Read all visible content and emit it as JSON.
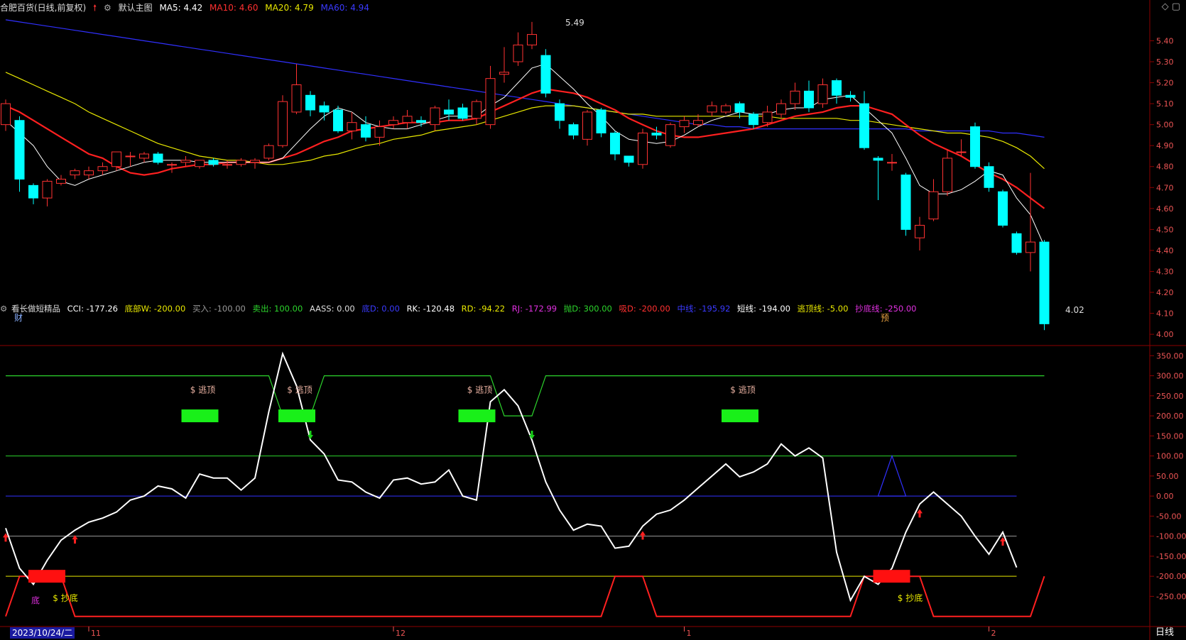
{
  "header": {
    "stock": "合肥百货(日线,前复权)",
    "main_chart": "默认主图",
    "ma5_label": "MA5: 4.42",
    "ma10_label": "MA10: 4.60",
    "ma20_label": "MA20: 4.79",
    "ma60_label": "MA60: 4.94"
  },
  "sub_header": {
    "indicator": "看长做短精品",
    "cci": "CCI: -177.26",
    "dibuw": "底部W: -200.00",
    "mairu": "买入: -100.00",
    "maichu": "卖出: 100.00",
    "aass": "AASS: 0.00",
    "di": "底D: 0.00",
    "rk": "RK: -120.48",
    "rd": "RD: -94.22",
    "rj": "RJ: -172.99",
    "paod": "抛D: 300.00",
    "xid": "吸D: -200.00",
    "zhongxian": "中线: -195.92",
    "duanxian": "短线: -194.00",
    "taodingxian": "逃顶线: -5.00",
    "chaodixian": "抄底线: -250.00"
  },
  "colors": {
    "up": "#ff3232",
    "down": "#00ffff",
    "ma5": "#ffffff",
    "ma10": "#ff2020",
    "ma20": "#e8e800",
    "ma60": "#3030ff",
    "grid": "#8b0000",
    "text": "#ddd"
  },
  "labels": {
    "high_marker": "5.49",
    "low_marker": "4.02",
    "cai": "财",
    "yu": "预",
    "escape": "$ 逃顶",
    "bottom": "$ 抄底",
    "di": "底",
    "date_box": "2023/10/24/二",
    "scope": "日线",
    "corner": "◇ ▢"
  },
  "chart_data": [
    {
      "type": "candlestick",
      "title": "合肥百货(日线,前复权)",
      "ylim": [
        3.97,
        5.52
      ],
      "yticks": [
        4.0,
        4.1,
        4.2,
        4.3,
        4.4,
        4.5,
        4.6,
        4.7,
        4.8,
        4.9,
        5.0,
        5.1,
        5.2,
        5.3,
        5.4
      ],
      "candles": [
        [
          5.0,
          5.1,
          5.12,
          4.97
        ],
        [
          5.02,
          4.74,
          5.04,
          4.68
        ],
        [
          4.71,
          4.65,
          4.72,
          4.62
        ],
        [
          4.65,
          4.73,
          4.74,
          4.61
        ],
        [
          4.72,
          4.74,
          4.76,
          4.71
        ],
        [
          4.76,
          4.78,
          4.79,
          4.74
        ],
        [
          4.76,
          4.78,
          4.8,
          4.74
        ],
        [
          4.78,
          4.8,
          4.82,
          4.76
        ],
        [
          4.8,
          4.87,
          4.87,
          4.78
        ],
        [
          4.85,
          4.85,
          4.87,
          4.8
        ],
        [
          4.84,
          4.86,
          4.87,
          4.82
        ],
        [
          4.86,
          4.82,
          4.87,
          4.81
        ],
        [
          4.81,
          4.81,
          4.82,
          4.77
        ],
        [
          4.82,
          4.83,
          4.85,
          4.8
        ],
        [
          4.8,
          4.83,
          4.83,
          4.79
        ],
        [
          4.83,
          4.81,
          4.84,
          4.8
        ],
        [
          4.81,
          4.81,
          4.83,
          4.79
        ],
        [
          4.81,
          4.83,
          4.84,
          4.8
        ],
        [
          4.82,
          4.83,
          4.84,
          4.79
        ],
        [
          4.84,
          4.9,
          4.91,
          4.83
        ],
        [
          4.9,
          5.11,
          5.14,
          4.89
        ],
        [
          5.06,
          5.19,
          5.29,
          5.05
        ],
        [
          5.14,
          5.07,
          5.16,
          5.04
        ],
        [
          5.09,
          5.06,
          5.11,
          5.02
        ],
        [
          5.07,
          4.97,
          5.09,
          4.96
        ],
        [
          4.97,
          5.01,
          5.06,
          4.93
        ],
        [
          5.0,
          4.94,
          5.04,
          4.92
        ],
        [
          4.94,
          4.99,
          5.02,
          4.9
        ],
        [
          5.0,
          5.02,
          5.04,
          4.98
        ],
        [
          5.01,
          5.04,
          5.07,
          4.98
        ],
        [
          5.02,
          5.01,
          5.04,
          4.99
        ],
        [
          5.0,
          5.08,
          5.09,
          4.97
        ],
        [
          5.07,
          5.05,
          5.12,
          5.02
        ],
        [
          5.08,
          5.03,
          5.1,
          5.02
        ],
        [
          5.03,
          5.11,
          5.12,
          5.0
        ],
        [
          5.0,
          5.22,
          5.28,
          4.98
        ],
        [
          5.24,
          5.25,
          5.37,
          5.2
        ],
        [
          5.3,
          5.38,
          5.44,
          5.28
        ],
        [
          5.38,
          5.43,
          5.49,
          5.36
        ],
        [
          5.33,
          5.15,
          5.36,
          5.13
        ],
        [
          5.1,
          5.02,
          5.12,
          4.98
        ],
        [
          5.0,
          4.95,
          5.01,
          4.93
        ],
        [
          4.93,
          5.06,
          5.07,
          4.9
        ],
        [
          5.07,
          4.96,
          5.08,
          4.94
        ],
        [
          4.96,
          4.86,
          4.97,
          4.83
        ],
        [
          4.85,
          4.82,
          4.85,
          4.8
        ],
        [
          4.81,
          4.96,
          4.98,
          4.79
        ],
        [
          4.96,
          4.95,
          4.99,
          4.93
        ],
        [
          4.9,
          5.0,
          5.01,
          4.89
        ],
        [
          4.99,
          5.02,
          5.04,
          4.96
        ],
        [
          5.0,
          5.02,
          5.05,
          4.99
        ],
        [
          5.06,
          5.09,
          5.11,
          5.04
        ],
        [
          5.06,
          5.09,
          5.1,
          5.05
        ],
        [
          5.1,
          5.06,
          5.11,
          5.03
        ],
        [
          5.05,
          5.0,
          5.06,
          4.98
        ],
        [
          5.01,
          5.06,
          5.09,
          4.99
        ],
        [
          5.05,
          5.1,
          5.12,
          5.03
        ],
        [
          5.1,
          5.16,
          5.2,
          5.07
        ],
        [
          5.16,
          5.08,
          5.21,
          5.06
        ],
        [
          5.1,
          5.19,
          5.22,
          5.08
        ],
        [
          5.21,
          5.14,
          5.22,
          5.1
        ],
        [
          5.14,
          5.13,
          5.16,
          5.11
        ],
        [
          5.1,
          4.89,
          5.16,
          4.88
        ],
        [
          4.84,
          4.83,
          4.85,
          4.64
        ],
        [
          4.82,
          4.82,
          4.86,
          4.78
        ],
        [
          4.76,
          4.5,
          4.77,
          4.47
        ],
        [
          4.46,
          4.52,
          4.56,
          4.4
        ],
        [
          4.55,
          4.68,
          4.74,
          4.54
        ],
        [
          4.68,
          4.84,
          4.88,
          4.66
        ],
        [
          4.87,
          4.87,
          4.93,
          4.85
        ],
        [
          4.99,
          4.8,
          5.01,
          4.79
        ],
        [
          4.8,
          4.7,
          4.82,
          4.68
        ],
        [
          4.68,
          4.52,
          4.69,
          4.51
        ],
        [
          4.48,
          4.39,
          4.49,
          4.38
        ],
        [
          4.39,
          4.44,
          4.77,
          4.3
        ],
        [
          4.44,
          4.05,
          4.45,
          4.02
        ]
      ],
      "ma5": [
        5.02,
        4.96,
        4.9,
        4.8,
        4.73,
        4.71,
        4.74,
        4.76,
        4.78,
        4.8,
        4.82,
        4.83,
        4.83,
        4.83,
        4.82,
        4.82,
        4.82,
        4.82,
        4.82,
        4.82,
        4.84,
        4.91,
        4.98,
        5.04,
        5.08,
        5.06,
        5.01,
        4.99,
        4.98,
        4.98,
        5.0,
        5.02,
        5.04,
        5.04,
        5.04,
        5.09,
        5.13,
        5.2,
        5.27,
        5.29,
        5.23,
        5.17,
        5.1,
        5.04,
        4.97,
        4.93,
        4.92,
        4.91,
        4.92,
        4.95,
        4.99,
        5.02,
        5.04,
        5.06,
        5.05,
        5.05,
        5.07,
        5.08,
        5.08,
        5.12,
        5.13,
        5.14,
        5.08,
        5.02,
        4.96,
        4.84,
        4.71,
        4.67,
        4.67,
        4.69,
        4.73,
        4.78,
        4.76,
        4.65,
        4.57,
        4.42
      ],
      "ma10": [
        5.09,
        5.06,
        5.02,
        4.98,
        4.94,
        4.9,
        4.86,
        4.84,
        4.8,
        4.77,
        4.76,
        4.77,
        4.79,
        4.8,
        4.81,
        4.81,
        4.82,
        4.82,
        4.82,
        4.82,
        4.84,
        4.86,
        4.89,
        4.92,
        4.94,
        4.97,
        4.98,
        4.99,
        5.0,
        5.01,
        5.01,
        5.01,
        5.02,
        5.02,
        5.03,
        5.06,
        5.09,
        5.12,
        5.15,
        5.17,
        5.16,
        5.15,
        5.13,
        5.1,
        5.07,
        5.03,
        5.0,
        4.97,
        4.95,
        4.94,
        4.94,
        4.95,
        4.96,
        4.97,
        4.98,
        5.0,
        5.02,
        5.04,
        5.05,
        5.06,
        5.08,
        5.09,
        5.09,
        5.07,
        5.05,
        5.0,
        4.95,
        4.91,
        4.88,
        4.85,
        4.81,
        4.77,
        4.74,
        4.7,
        4.65,
        4.6
      ],
      "ma20": [
        5.25,
        5.22,
        5.19,
        5.16,
        5.13,
        5.1,
        5.06,
        5.03,
        5.0,
        4.97,
        4.94,
        4.91,
        4.89,
        4.87,
        4.85,
        4.84,
        4.83,
        4.83,
        4.82,
        4.81,
        4.81,
        4.82,
        4.83,
        4.85,
        4.86,
        4.88,
        4.9,
        4.91,
        4.93,
        4.94,
        4.95,
        4.97,
        4.98,
        4.99,
        5.0,
        5.02,
        5.04,
        5.06,
        5.08,
        5.09,
        5.09,
        5.09,
        5.08,
        5.07,
        5.06,
        5.05,
        5.05,
        5.04,
        5.04,
        5.04,
        5.04,
        5.04,
        5.04,
        5.04,
        5.04,
        5.04,
        5.03,
        5.03,
        5.03,
        5.03,
        5.03,
        5.02,
        5.02,
        5.01,
        5.0,
        4.99,
        4.98,
        4.97,
        4.96,
        4.96,
        4.95,
        4.94,
        4.92,
        4.89,
        4.85,
        4.79
      ],
      "ma60": [
        5.5,
        5.49,
        5.48,
        5.47,
        5.46,
        5.45,
        5.44,
        5.43,
        5.42,
        5.41,
        5.4,
        5.39,
        5.38,
        5.37,
        5.36,
        5.35,
        5.34,
        5.33,
        5.32,
        5.31,
        5.3,
        5.29,
        5.28,
        5.27,
        5.26,
        5.25,
        5.24,
        5.23,
        5.22,
        5.21,
        5.2,
        5.19,
        5.18,
        5.17,
        5.16,
        5.15,
        5.14,
        5.13,
        5.12,
        5.11,
        5.1,
        5.09,
        5.08,
        5.07,
        5.06,
        5.05,
        5.04,
        5.03,
        5.02,
        5.01,
        5.0,
        5.0,
        4.99,
        4.99,
        4.98,
        4.98,
        4.98,
        4.98,
        4.98,
        4.98,
        4.98,
        4.98,
        4.98,
        4.98,
        4.98,
        4.98,
        4.97,
        4.97,
        4.97,
        4.97,
        4.97,
        4.97,
        4.96,
        4.96,
        4.95,
        4.94
      ]
    },
    {
      "type": "line",
      "title": "看长做短精品",
      "ylim": [
        -320,
        370
      ],
      "yticks": [
        350,
        300,
        250,
        200,
        150,
        100,
        50,
        0,
        -50,
        -100,
        -150,
        -200,
        -250
      ],
      "hlines": {
        "maichu": 100,
        "zero": 0,
        "mairu": -100,
        "dibuw": -200
      },
      "cci": [
        -80,
        -180,
        -220,
        -160,
        -110,
        -85,
        -65,
        -55,
        -40,
        -10,
        0,
        25,
        18,
        -5,
        55,
        45,
        45,
        15,
        45,
        210,
        355,
        275,
        140,
        105,
        40,
        35,
        10,
        -5,
        40,
        45,
        30,
        35,
        65,
        0,
        -10,
        235,
        265,
        225,
        140,
        35,
        -35,
        -85,
        -70,
        -75,
        -130,
        -125,
        -75,
        -45,
        -35,
        -10,
        20,
        50,
        80,
        48,
        60,
        80,
        130,
        100,
        120,
        95,
        -140,
        -260,
        -200,
        -220,
        -180,
        -90,
        -20,
        10,
        -20,
        -50,
        -100,
        -145,
        -90,
        -178
      ],
      "taoding_line": [
        300,
        300,
        300,
        300,
        300,
        300,
        300,
        300,
        300,
        300,
        300,
        300,
        300,
        300,
        300,
        300,
        300,
        300,
        300,
        300,
        200,
        200,
        200,
        300,
        300,
        300,
        300,
        300,
        300,
        300,
        300,
        300,
        300,
        300,
        300,
        300,
        200,
        200,
        200,
        300,
        300,
        300,
        300,
        300,
        300,
        300,
        300,
        300,
        300,
        300,
        300,
        300,
        300,
        300,
        300,
        300,
        300,
        300,
        300,
        300,
        300,
        300,
        300,
        300,
        300,
        300,
        300,
        300,
        300,
        300,
        300,
        300,
        300,
        300,
        300,
        300
      ],
      "chaodi_line": [
        -300,
        -200,
        -200,
        -200,
        -200,
        -300,
        -300,
        -300,
        -300,
        -300,
        -300,
        -300,
        -300,
        -300,
        -300,
        -300,
        -300,
        -300,
        -300,
        -300,
        -300,
        -300,
        -300,
        -300,
        -300,
        -300,
        -300,
        -300,
        -300,
        -300,
        -300,
        -300,
        -300,
        -300,
        -300,
        -300,
        -300,
        -300,
        -300,
        -300,
        -300,
        -300,
        -300,
        -300,
        -200,
        -200,
        -200,
        -300,
        -300,
        -300,
        -300,
        -300,
        -300,
        -300,
        -300,
        -300,
        -300,
        -300,
        -300,
        -300,
        -300,
        -300,
        -200,
        -200,
        -200,
        -200,
        -200,
        -300,
        -300,
        -300,
        -300,
        -300,
        -300,
        -300,
        -300,
        -200
      ],
      "escape_marks": [
        13,
        20,
        33,
        52
      ],
      "bottom_marks": [
        2,
        63
      ],
      "buy_arrows": [
        0,
        5,
        46,
        66,
        72
      ],
      "sell_arrows": [
        22,
        38
      ],
      "triangle": {
        "x_from": 63,
        "x_to": 65,
        "peak": 100
      },
      "month_ticks": [
        {
          "i": 6,
          "label": "11"
        },
        {
          "i": 28,
          "label": "12"
        },
        {
          "i": 49,
          "label": "1"
        },
        {
          "i": 71,
          "label": "2"
        }
      ]
    }
  ]
}
